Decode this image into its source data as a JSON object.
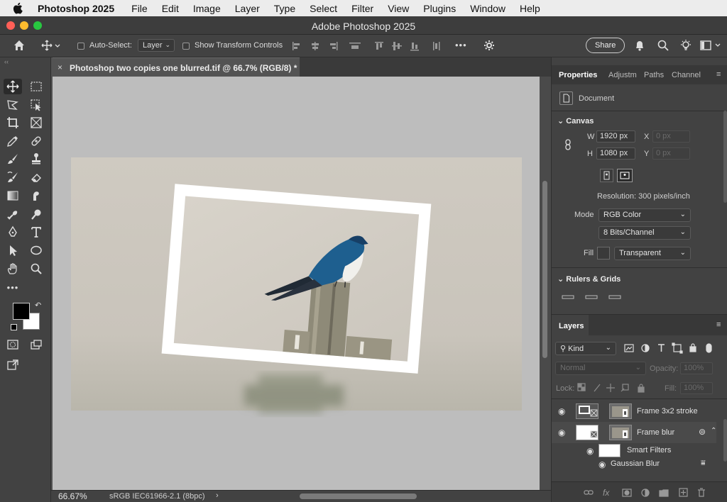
{
  "menubar": {
    "app_name": "Photoshop 2025",
    "items": [
      "File",
      "Edit",
      "Image",
      "Layer",
      "Type",
      "Select",
      "Filter",
      "View",
      "Plugins",
      "Window",
      "Help"
    ]
  },
  "window": {
    "title": "Adobe Photoshop 2025",
    "traffic_colors": [
      "#ff5f57",
      "#febc2e",
      "#28c840"
    ]
  },
  "options": {
    "auto_select_label": "Auto-Select:",
    "auto_select_value": "Layer",
    "transform_label": "Show Transform Controls",
    "more": "•••",
    "share_label": "Share"
  },
  "document": {
    "tab_title": "Photoshop two copies one blurred.tif @ 66.7% (RGB/8) *",
    "close": "×"
  },
  "status": {
    "zoom": "66.67%",
    "profile": "sRGB IEC61966-2.1 (8bpc)",
    "arrow": "›"
  },
  "panel": {
    "tabs": [
      "Properties",
      "Adjustm",
      "Paths",
      "Channel"
    ],
    "document_label": "Document",
    "canvas_header": "Canvas",
    "w_label": "W",
    "w_value": "1920 px",
    "h_label": "H",
    "h_value": "1080 px",
    "x_label": "X",
    "x_placeholder": "0 px",
    "y_label": "Y",
    "y_placeholder": "0 px",
    "resolution": "Resolution: 300 pixels/inch",
    "mode_label": "Mode",
    "mode_value": "RGB Color",
    "bits_value": "8 Bits/Channel",
    "fill_label": "Fill",
    "fill_value": "Transparent",
    "rulers_header": "Rulers & Grids"
  },
  "layers": {
    "header": "Layers",
    "kind_label": "Kind",
    "blend_mode": "Normal",
    "opacity_label": "Opacity:",
    "opacity_value": "100%",
    "lock_label": "Lock:",
    "fill_label": "Fill:",
    "fill_value": "100%",
    "rows": [
      {
        "name": "Frame 3x2 stroke"
      },
      {
        "name": "Frame blur"
      },
      {
        "name": "Smart Filters"
      },
      {
        "name": "Gaussian Blur"
      }
    ]
  },
  "colors": {
    "foreground": "#000000",
    "background": "#ffffff",
    "bird_blue": "#1e5f8f"
  }
}
